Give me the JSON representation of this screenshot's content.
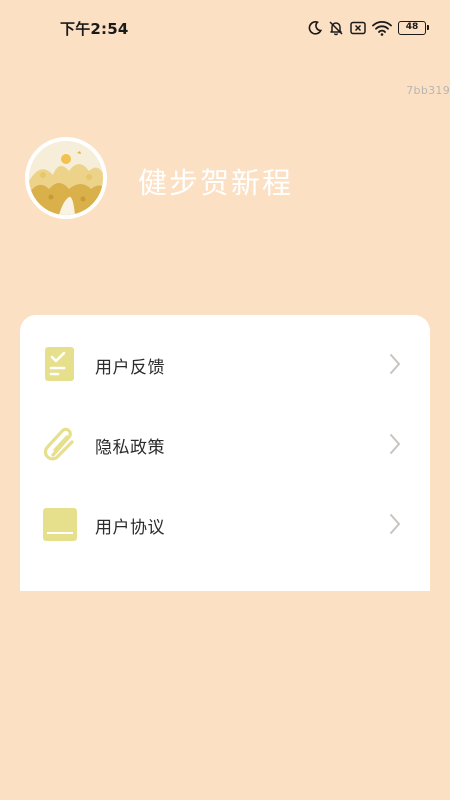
{
  "status_bar": {
    "time": "下午2:54",
    "battery": "48",
    "icons": [
      "moon-icon",
      "bell-muted-icon",
      "sim-off-icon",
      "wifi-icon",
      "battery-icon"
    ]
  },
  "build_id": "7bb319",
  "profile": {
    "app_name": "健步贺新程",
    "avatar_icon": "avatar-illustration-icon"
  },
  "menu": {
    "items": [
      {
        "label": "用户反馈",
        "icon": "feedback-clipboard-icon"
      },
      {
        "label": "隐私政策",
        "icon": "paperclip-icon"
      },
      {
        "label": "用户协议",
        "icon": "agreement-icon"
      }
    ]
  },
  "colors": {
    "background": "#fbe0c4",
    "card": "#ffffff",
    "icon_accent": "#e6df8c",
    "chevron": "#c9c2bd",
    "app_name": "#ffffff"
  }
}
